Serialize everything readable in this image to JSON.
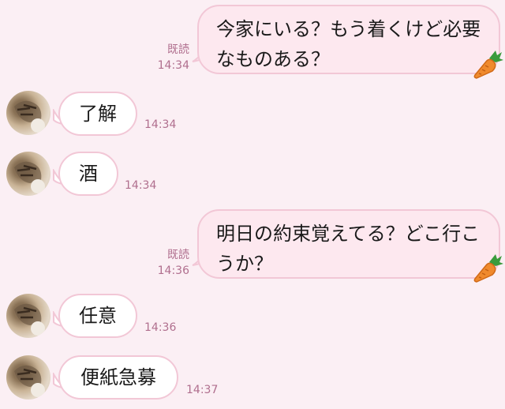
{
  "messages": [
    {
      "direction": "out",
      "text": "今家にいる？もう着くけど必要なものある？",
      "read_label": "既読",
      "time": "14:34"
    },
    {
      "direction": "in",
      "text": "了解",
      "time": "14:34"
    },
    {
      "direction": "in",
      "text": "酒",
      "time": "14:34"
    },
    {
      "direction": "out",
      "text": "明日の約束覚えてる？どこ行こうか？",
      "read_label": "既読",
      "time": "14:36"
    },
    {
      "direction": "in",
      "text": "任意",
      "time": "14:36"
    },
    {
      "direction": "in",
      "text": "便紙急募",
      "time": "14:37"
    }
  ],
  "icons": {
    "avatar": "cat-avatar-icon",
    "sticker": "carrot-icon"
  },
  "colors": {
    "background": "#fbeff4",
    "outgoing_bubble": "#fde8ef",
    "bubble_border": "#f2c7d6",
    "meta_text": "#b06f8e"
  }
}
